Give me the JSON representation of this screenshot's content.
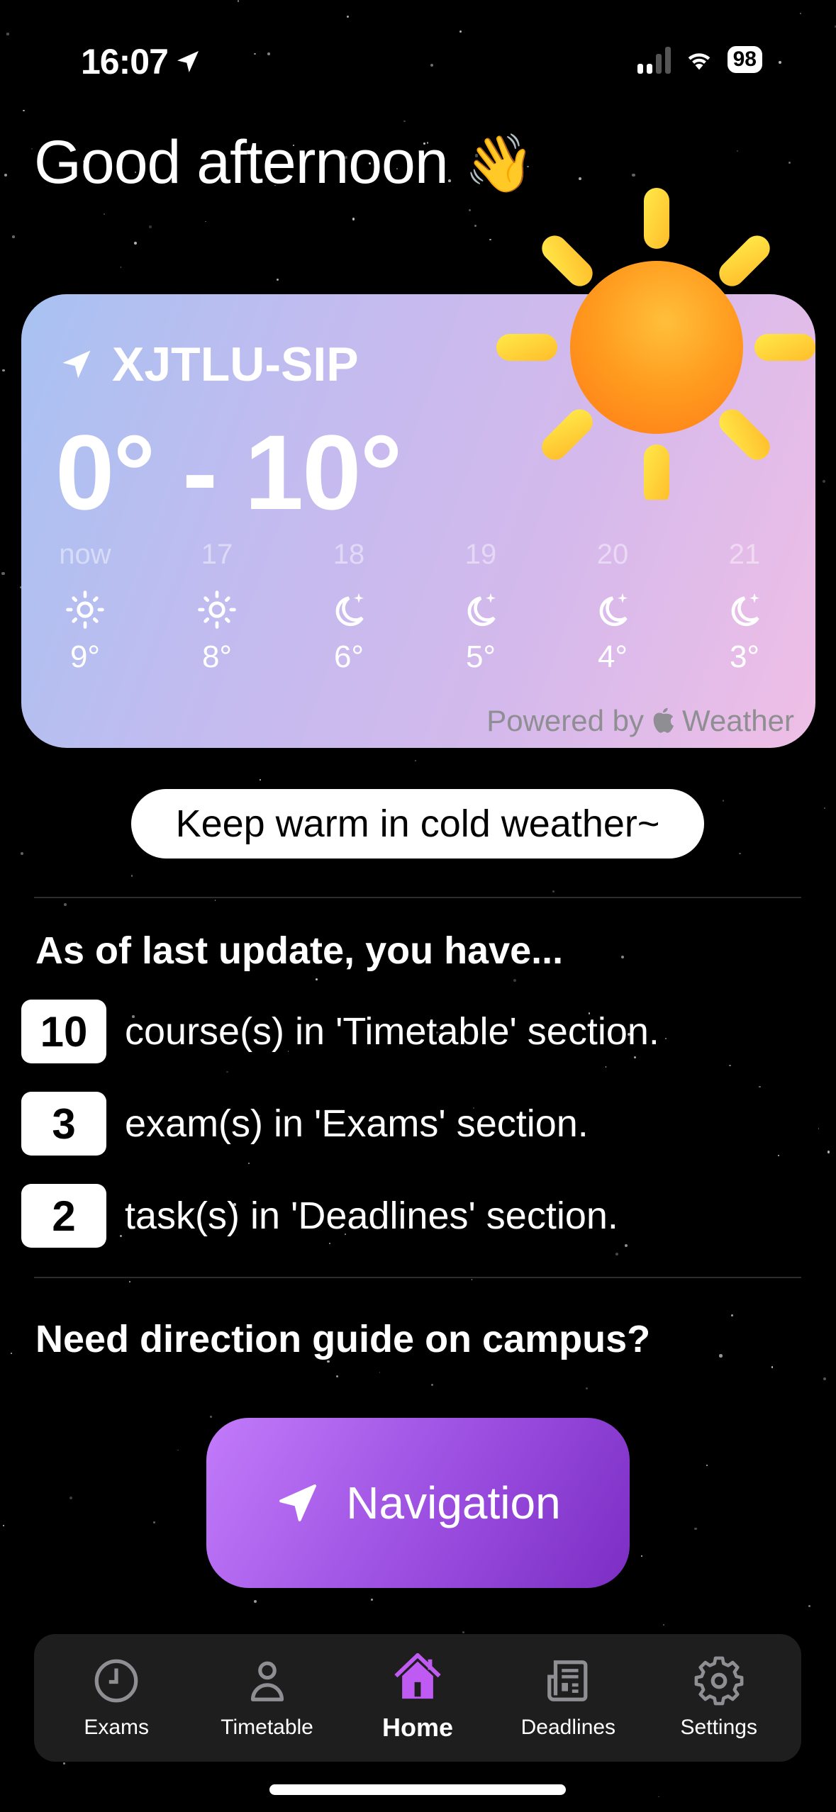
{
  "status_bar": {
    "time": "16:07",
    "battery": "98"
  },
  "greeting": {
    "text": "Good afternoon",
    "emoji": "👋"
  },
  "weather": {
    "location": "XJTLU-SIP",
    "temp_range": "0° - 10°",
    "condition_icon": "sun-icon",
    "hourly": [
      {
        "label": "now",
        "icon": "sun",
        "temp": "9°"
      },
      {
        "label": "17",
        "icon": "sun",
        "temp": "8°"
      },
      {
        "label": "18",
        "icon": "moon-stars",
        "temp": "6°"
      },
      {
        "label": "19",
        "icon": "moon-stars",
        "temp": "5°"
      },
      {
        "label": "20",
        "icon": "moon-stars",
        "temp": "4°"
      },
      {
        "label": "21",
        "icon": "moon-stars",
        "temp": "3°"
      }
    ],
    "powered_by_prefix": "Powered by",
    "powered_by_suffix": "Weather"
  },
  "tip": "Keep warm in cold weather~",
  "summary": {
    "title": "As of last update, you have...",
    "items": [
      {
        "count": "10",
        "text": "course(s) in 'Timetable' section."
      },
      {
        "count": "3",
        "text": "exam(s) in 'Exams' section."
      },
      {
        "count": "2",
        "text": "task(s) in 'Deadlines' section."
      }
    ]
  },
  "navigation": {
    "prompt": "Need direction guide on campus?",
    "button_label": "Navigation"
  },
  "tab_bar": {
    "active": "Home",
    "accent_color": "#bf5af2",
    "tabs": [
      {
        "label": "Exams",
        "icon": "clock"
      },
      {
        "label": "Timetable",
        "icon": "person"
      },
      {
        "label": "Home",
        "icon": "house"
      },
      {
        "label": "Deadlines",
        "icon": "newspaper"
      },
      {
        "label": "Settings",
        "icon": "gear"
      }
    ]
  }
}
